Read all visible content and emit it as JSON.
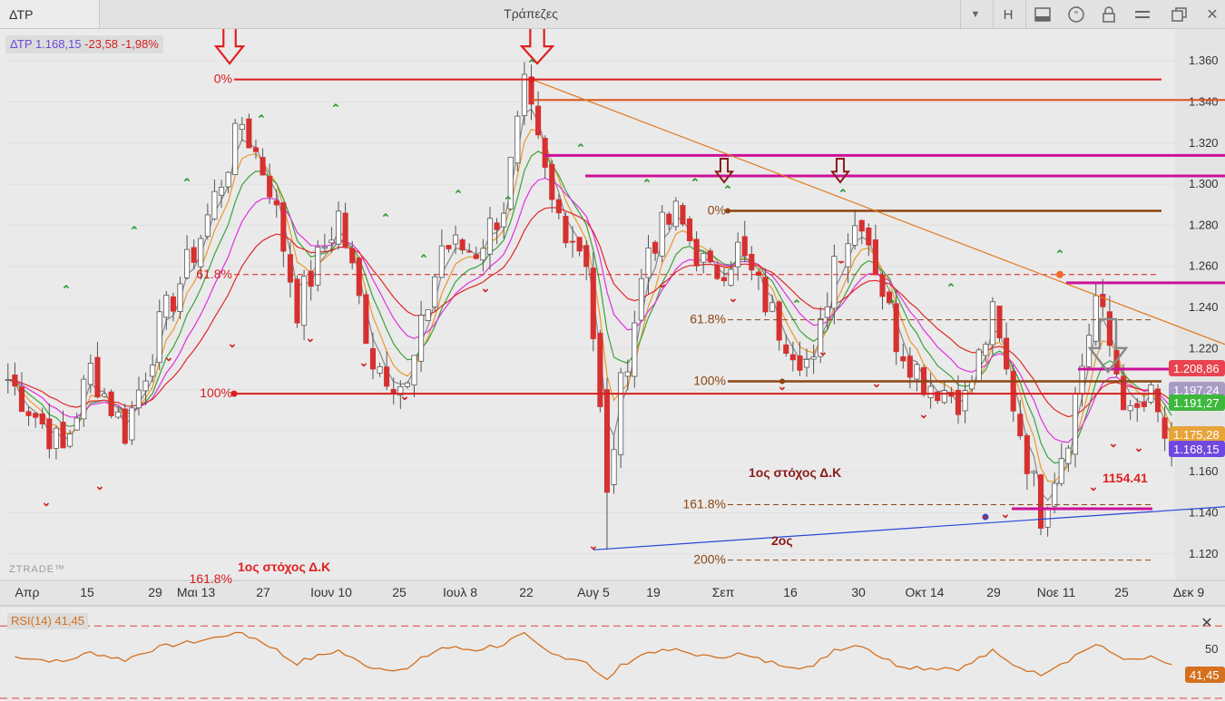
{
  "window": {
    "symbol": "ΔΤΡ",
    "title": "Τράπεζες",
    "buttons": {
      "h_label": "H"
    }
  },
  "header": {
    "symbol": "ΔΤΡ",
    "price": "1.168,15",
    "change": "-23,58",
    "change_pct": "-1,98%"
  },
  "watermark": "ZTRADE™",
  "annotations": {
    "fib_left": {
      "zero": "0%",
      "f618": "61.8%",
      "hundred": "100%",
      "f1618": "161.8%"
    },
    "fib_right": {
      "zero": "0%",
      "f618": "61.8%",
      "hundred": "100%",
      "f1618": "161.8%",
      "f200": "200%"
    },
    "target1": "1ος στόχος Δ.Κ",
    "target2": "2ος",
    "target1_bottom": "1ος στόχος Δ.Κ",
    "level_value": "1154.41"
  },
  "price_tags": [
    {
      "text": "1.208,86",
      "color": "#e8434f",
      "value": 1.20886
    },
    {
      "text": "1.197,24",
      "color": "#a89bc4",
      "value": 1.19724
    },
    {
      "text": "1.191,27",
      "color": "#3db83d",
      "value": 1.19127
    },
    {
      "text": "1.175,28",
      "color": "#e8a43a",
      "value": 1.17528
    },
    {
      "text": "1.168,15",
      "color": "#7048e0",
      "value": 1.16815
    }
  ],
  "rsi": {
    "label": "RSI(14)",
    "value": "41,45",
    "axis_label": "50"
  },
  "colors": {
    "up": "#ffffff",
    "down": "#d63030",
    "ma_gray": "#888888",
    "ma_orange": "#e89a2c",
    "ma_green": "#3aa33a",
    "ma_magenta": "#e030e0",
    "ma_red": "#e02828",
    "trend_blue": "#2747d8",
    "trend_orange": "#e07a20",
    "magenta_line": "#cc1199",
    "fib_red": "#d81e1e",
    "fib_brown": "#8b4513",
    "rsi": "#d4701e"
  },
  "chart_data": {
    "type": "line",
    "title": "",
    "ylim": [
      1.108,
      1.372
    ],
    "y_ticks": [
      "1.120",
      "1.140",
      "1.160",
      "1.180",
      "1.200",
      "1.220",
      "1.240",
      "1.260",
      "1.280",
      "1.300",
      "1.320",
      "1.340",
      "1.360"
    ],
    "x_ticks": [
      "Απρ",
      "15",
      "29",
      "Μαι 13",
      "27",
      "Ιουν 10",
      "25",
      "Ιουλ 8",
      "22",
      "Αυγ 5",
      "19",
      "Σεπ",
      "16",
      "30",
      "Οκτ 14",
      "29",
      "Νοε 11",
      "25",
      "Δεκ 9"
    ],
    "n_bars": 170,
    "close_series": {
      "name": "ΔΤΡ",
      "values_desc": "daily closes, see keypoints",
      "keypoints": [
        [
          0,
          1.205
        ],
        [
          8,
          1.17
        ],
        [
          12,
          1.21
        ],
        [
          17,
          1.18
        ],
        [
          22,
          1.23
        ],
        [
          28,
          1.275
        ],
        [
          34,
          1.33
        ],
        [
          38,
          1.3
        ],
        [
          42,
          1.24
        ],
        [
          48,
          1.285
        ],
        [
          53,
          1.215
        ],
        [
          58,
          1.2
        ],
        [
          63,
          1.27
        ],
        [
          68,
          1.268
        ],
        [
          72,
          1.29
        ],
        [
          75,
          1.345
        ],
        [
          79,
          1.29
        ],
        [
          84,
          1.265
        ],
        [
          87,
          1.15
        ],
        [
          89,
          1.2
        ],
        [
          93,
          1.27
        ],
        [
          97,
          1.285
        ],
        [
          102,
          1.255
        ],
        [
          106,
          1.268
        ],
        [
          112,
          1.23
        ],
        [
          117,
          1.21
        ],
        [
          120,
          1.265
        ],
        [
          124,
          1.285
        ],
        [
          129,
          1.225
        ],
        [
          133,
          1.205
        ],
        [
          139,
          1.195
        ],
        [
          143,
          1.235
        ],
        [
          147,
          1.18
        ],
        [
          150,
          1.14
        ],
        [
          154,
          1.18
        ],
        [
          158,
          1.245
        ],
        [
          163,
          1.185
        ],
        [
          166,
          1.195
        ],
        [
          169,
          1.168
        ]
      ]
    },
    "rsi_ylim": [
      0,
      100
    ]
  }
}
